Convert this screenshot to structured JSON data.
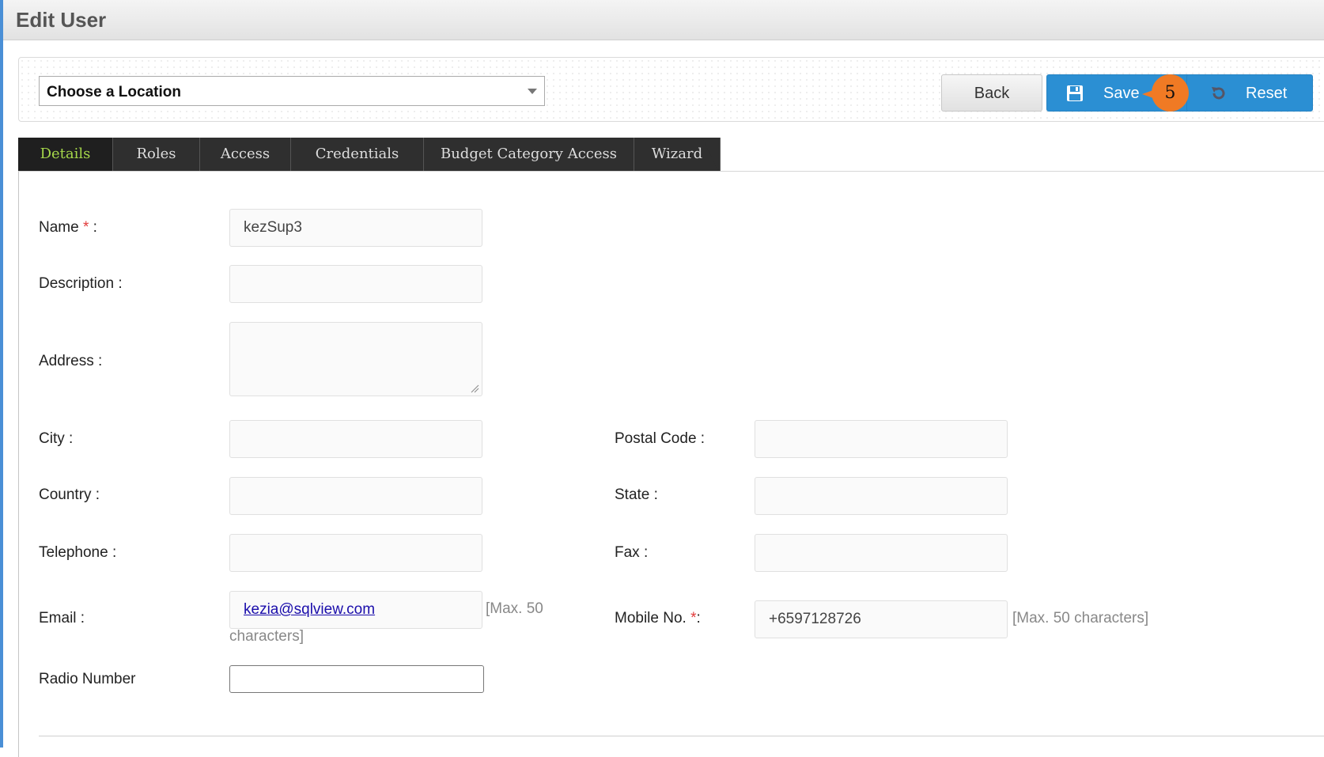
{
  "page": {
    "title": "Edit User"
  },
  "toolbar": {
    "location_value": "Choose a Location",
    "back_label": "Back",
    "save_label": "Save",
    "reset_label": "Reset",
    "step_badge": "5",
    "accent_color": "#2b8fd3",
    "badge_color": "#f07a24"
  },
  "tabs": [
    {
      "label": "Details",
      "active": true
    },
    {
      "label": "Roles"
    },
    {
      "label": "Access"
    },
    {
      "label": "Credentials"
    },
    {
      "label": "Budget Category Access"
    },
    {
      "label": "Wizard"
    }
  ],
  "form": {
    "name": {
      "label": "Name",
      "required_mark": "*",
      "colon": " :",
      "value": "kezSup3"
    },
    "description": {
      "label": "Description :",
      "value": ""
    },
    "address": {
      "label": "Address :",
      "value": ""
    },
    "city": {
      "label": "City :",
      "value": ""
    },
    "postal_code": {
      "label": "Postal Code :",
      "value": ""
    },
    "country": {
      "label": "Country :",
      "value": ""
    },
    "state": {
      "label": "State :",
      "value": ""
    },
    "telephone": {
      "label": "Telephone :",
      "value": ""
    },
    "fax": {
      "label": "Fax :",
      "value": ""
    },
    "email": {
      "label": "Email :",
      "value": "kezia@sqlview.com",
      "hint_line1": "[Max. 50",
      "hint_line2": "characters]"
    },
    "mobile": {
      "label": "Mobile No.",
      "required_mark": "*",
      "colon": ":",
      "value": "+6597128726",
      "hint": "[Max. 50 characters]"
    },
    "radio_number": {
      "label": "Radio Number",
      "value": ""
    }
  }
}
